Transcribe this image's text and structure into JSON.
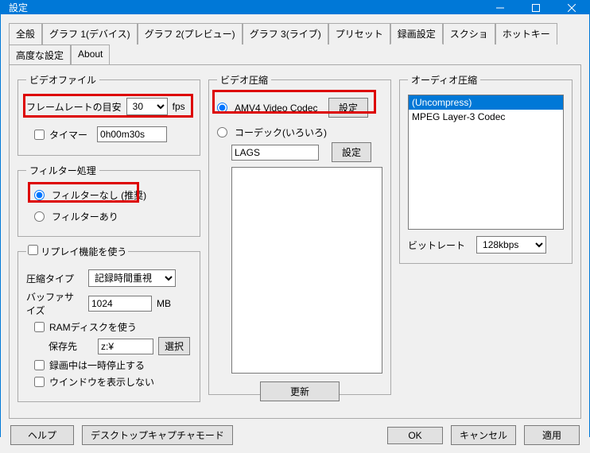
{
  "window": {
    "title": "設定"
  },
  "tabs": [
    {
      "label": "全般"
    },
    {
      "label": "グラフ 1(デバイス)"
    },
    {
      "label": "グラフ 2(プレビュー)"
    },
    {
      "label": "グラフ 3(ライブ)"
    },
    {
      "label": "プリセット"
    },
    {
      "label": "録画設定",
      "active": true
    },
    {
      "label": "スクショ"
    },
    {
      "label": "ホットキー"
    },
    {
      "label": "高度な設定"
    },
    {
      "label": "About"
    }
  ],
  "video_file": {
    "legend": "ビデオファイル",
    "framerate_label": "フレームレートの目安",
    "framerate_value": "30",
    "framerate_unit": "fps",
    "timer_label": "タイマー",
    "timer_value": "0h00m30s"
  },
  "filter": {
    "legend": "フィルター処理",
    "none_label": "フィルターなし (推奨)",
    "some_label": "フィルターあり"
  },
  "replay": {
    "legend": "リプレイ機能を使う",
    "compress_type_label": "圧縮タイプ",
    "compress_type_value": "記録時間重視",
    "buffer_label": "バッファサイズ",
    "buffer_value": "1024",
    "buffer_unit": "MB",
    "ramdisk_label": "RAMディスクを使う",
    "save_dest_label": "保存先",
    "save_dest_value": "z:¥",
    "select_button": "選択",
    "pause_label": "録画中は一時停止する",
    "hide_window_label": "ウインドウを表示しない"
  },
  "video_compress": {
    "legend": "ビデオ圧縮",
    "amv4_label": "AMV4 Video Codec",
    "amv4_settings_button": "設定",
    "codec_misc_label": "コーデック(いろいろ)",
    "codec_value": "LAGS",
    "codec_settings_button": "設定",
    "update_button": "更新"
  },
  "audio_compress": {
    "legend": "オーディオ圧縮",
    "items": [
      {
        "label": "(Uncompress)",
        "selected": true
      },
      {
        "label": "MPEG Layer-3 Codec",
        "selected": false
      }
    ],
    "bitrate_label": "ビットレート",
    "bitrate_value": "128kbps"
  },
  "footer": {
    "help": "ヘルプ",
    "desktop_capture": "デスクトップキャプチャモード",
    "ok": "OK",
    "cancel": "キャンセル",
    "apply": "適用"
  }
}
